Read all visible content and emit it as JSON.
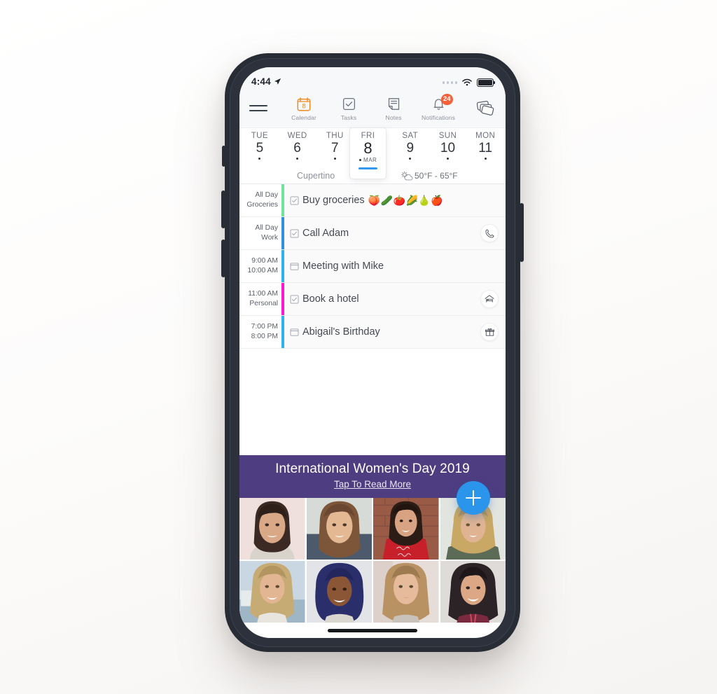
{
  "status_bar": {
    "time": "4:44",
    "location_arrow_icon": "navigation-arrow-icon",
    "cellular_icon": "cellular-dots-icon",
    "wifi_icon": "wifi-icon",
    "battery_icon": "battery-full-icon"
  },
  "top_nav": {
    "menu_icon": "hamburger-menu-icon",
    "cards_icon": "stacked-cards-icon",
    "tabs": [
      {
        "label": "Calendar",
        "icon": "calendar-icon",
        "day_number": "8",
        "active": true,
        "badge": ""
      },
      {
        "label": "Tasks",
        "icon": "checkmark-box-icon",
        "active": false,
        "badge": ""
      },
      {
        "label": "Notes",
        "icon": "note-page-icon",
        "active": false,
        "badge": ""
      },
      {
        "label": "Notifications",
        "icon": "bell-icon",
        "active": false,
        "badge": "24"
      }
    ]
  },
  "date_strip": {
    "days": [
      {
        "dow": "TUE",
        "num": "5",
        "has_dot": true,
        "selected": false
      },
      {
        "dow": "WED",
        "num": "6",
        "has_dot": true,
        "selected": false
      },
      {
        "dow": "THU",
        "num": "7",
        "has_dot": true,
        "selected": false
      },
      {
        "dow": "FRI",
        "num": "8",
        "month": "MAR",
        "has_dot": true,
        "selected": true
      },
      {
        "dow": "SAT",
        "num": "9",
        "has_dot": true,
        "selected": false
      },
      {
        "dow": "SUN",
        "num": "10",
        "has_dot": true,
        "selected": false
      },
      {
        "dow": "MON",
        "num": "11",
        "has_dot": true,
        "selected": false
      }
    ],
    "city": "Cupertino",
    "weather_icon": "sun-behind-cloud-icon",
    "weather_range": "50°F - 65°F",
    "accent_color": "#3498ef"
  },
  "events": [
    {
      "time_start": "All Day",
      "time_end": "Groceries",
      "bar_color": "#6ee59b",
      "kind_icon": "checkbox-icon",
      "title": "Buy groceries",
      "emoji": "🍑🥒🍅🌽🍐🍎",
      "action_icon": ""
    },
    {
      "time_start": "All Day",
      "time_end": "Work",
      "bar_color": "#2f8fe8",
      "kind_icon": "checkbox-icon",
      "title": "Call Adam",
      "emoji": "",
      "action_icon": "phone-icon"
    },
    {
      "time_start": "9:00 AM",
      "time_end": "10:00 AM",
      "bar_color": "#2bb3f0",
      "kind_icon": "calendar-event-icon",
      "title": "Meeting with Mike",
      "emoji": "",
      "action_icon": ""
    },
    {
      "time_start": "11:00 AM",
      "time_end": "Personal",
      "bar_color": "#ff16d4",
      "kind_icon": "checkbox-icon",
      "title": "Book a hotel",
      "emoji": "",
      "action_icon": "hotel-bed-icon"
    },
    {
      "time_start": "7:00 PM",
      "time_end": "8:00 PM",
      "bar_color": "#2bb3f0",
      "kind_icon": "calendar-event-icon",
      "title": "Abigail's Birthday",
      "emoji": "",
      "action_icon": "gift-icon"
    }
  ],
  "banner": {
    "title": "International Women's Day 2019",
    "link": "Tap To Read More",
    "background_color": "#4e3d80"
  },
  "photo_grid": {
    "photos": [
      {
        "alt": "portrait-1",
        "bg": "#efe0de",
        "hair": "#3b2a24",
        "skin": "#d9a886",
        "top": "#d8d4cb"
      },
      {
        "alt": "portrait-2",
        "bg": "#d7dbd8",
        "hair": "#7d563a",
        "skin": "#e4b893",
        "top": "#4c5a6b"
      },
      {
        "alt": "portrait-3",
        "bg": "#9a5b46",
        "hair": "#2c1c16",
        "skin": "#d8a382",
        "top": "#c8202a"
      },
      {
        "alt": "portrait-4",
        "bg": "#e2e4e0",
        "hair": "#c9a765",
        "skin": "#e0b493",
        "top": "#5c6b55"
      },
      {
        "alt": "portrait-5",
        "bg": "#c8d7e2",
        "hair": "#c7ab75",
        "skin": "#e2b593",
        "top": "#e8e4de"
      },
      {
        "alt": "portrait-6",
        "bg": "#e3e4e7",
        "hair": "#2a2e6b",
        "skin": "#8a5636",
        "top": "#d9d5cf"
      },
      {
        "alt": "portrait-7",
        "bg": "#e6dcd8",
        "hair": "#b99264",
        "skin": "#e6bb9b",
        "top": "#c9c2bb"
      },
      {
        "alt": "portrait-8",
        "bg": "#dedbd9",
        "hair": "#2c2326",
        "skin": "#dba785",
        "top": "#7a2a3e"
      }
    ]
  },
  "fab": {
    "icon": "plus-icon",
    "color": "#2b95ec"
  },
  "home_indicator": "home-indicator-bar"
}
